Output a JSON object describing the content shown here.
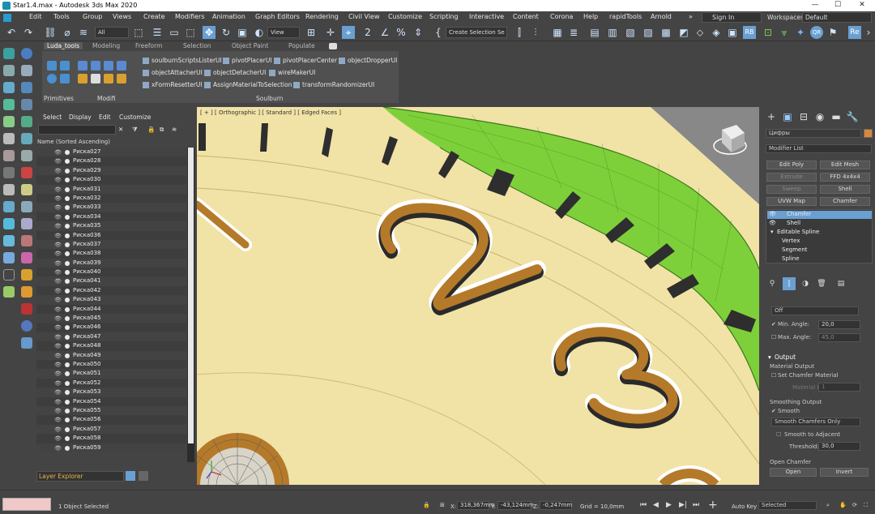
{
  "window": {
    "title": "Star1.4.max - Autodesk 3ds Max 2020"
  },
  "menu": [
    "Edit",
    "Tools",
    "Group",
    "Views",
    "Create",
    "Modifiers",
    "Animation",
    "Graph Editors",
    "Rendering",
    "Civil View",
    "Customize",
    "Scripting",
    "Interactive",
    "Content",
    "Corona",
    "Help",
    "rapidTools",
    "Arnold"
  ],
  "menu_more": "»",
  "signin": "Sign In",
  "workspaces": {
    "label": "Workspaces:",
    "value": "Default"
  },
  "toolbar": {
    "filter": "All",
    "view": "View",
    "selection_set": "Create Selection Se"
  },
  "ribbon": {
    "tabs": [
      "Luda_tools",
      "Modeling",
      "Freeform",
      "Selection",
      "Object Paint",
      "Populate"
    ],
    "links": [
      "soulburnScriptsListerUI",
      "pivotPlacerUI",
      "pivotPlacerCenter",
      "objectDropperUI",
      "objectAttacherUI",
      "objectDetacherUI",
      "wireMakerUI",
      "xFormResetterUI",
      "AssignMaterialToSelection",
      "transformRandomizerUI"
    ],
    "groups": [
      "Primitives",
      "Modifi",
      "Soulburn"
    ]
  },
  "scene_explorer": {
    "menus": [
      "Select",
      "Display",
      "Edit",
      "Customize"
    ],
    "header": "Name (Sorted Ascending)",
    "items": [
      "Риска027",
      "Риска028",
      "Риска029",
      "Риска030",
      "Риска031",
      "Риска032",
      "Риска033",
      "Риска034",
      "Риска035",
      "Риска036",
      "Риска037",
      "Риска038",
      "Риска039",
      "Риска040",
      "Риска041",
      "Риска042",
      "Риска043",
      "Риска044",
      "Риска045",
      "Риска046",
      "Риска047",
      "Риска048",
      "Риска049",
      "Риска050",
      "Риска051",
      "Риска052",
      "Риска053",
      "Риска054",
      "Риска055",
      "Риска056",
      "Риска057",
      "Риска058",
      "Риска059"
    ],
    "layer_explorer": "Layer Explorer"
  },
  "viewport": {
    "label": "[ + ] [ Orthographic ] [ Standard ] [ Edged Faces ]"
  },
  "command_panel": {
    "object_name": "Цифры",
    "modifier_list": "Modifier List",
    "buttons": [
      {
        "label": "Edit Poly",
        "enabled": true
      },
      {
        "label": "Edit Mesh",
        "enabled": true
      },
      {
        "label": "Extrude",
        "enabled": false
      },
      {
        "label": "FFD 4x4x4",
        "enabled": true
      },
      {
        "label": "Sweep",
        "enabled": false
      },
      {
        "label": "Shell",
        "enabled": true
      },
      {
        "label": "UVW Map",
        "enabled": true
      },
      {
        "label": "Chamfer",
        "enabled": true
      }
    ],
    "stack": [
      "Chamfer",
      "Shell",
      "Editable Spline",
      "Vertex",
      "Segment",
      "Spline"
    ],
    "off_value": "Off",
    "min_angle_label": "Min. Angle:",
    "min_angle": "20,0",
    "max_angle_label": "Max. Angle:",
    "max_angle": "45,0",
    "output_title": "Output",
    "material_output": "Material Output",
    "set_chamfer_material": "Set Chamfer Material",
    "material_id_label": "Material ID:",
    "material_id": "1",
    "smoothing_output": "Smoothing Output",
    "smooth": "Smooth",
    "smooth_mode": "Smooth Chamfers Only",
    "smooth_adjacent": "Smooth to Adjacent",
    "threshold_label": "Threshold:",
    "threshold": "30,0",
    "open_chamfer": "Open Chamfer",
    "open_btn": "Open",
    "invert_btn": "Invert"
  },
  "status": {
    "selected": "1 Object Selected",
    "x": "318,367mm",
    "y": "-43,124mm",
    "z": "-0,247mm",
    "grid": "Grid = 10,0mm",
    "autokey": "Auto Key",
    "selected_dd": "Selected"
  }
}
